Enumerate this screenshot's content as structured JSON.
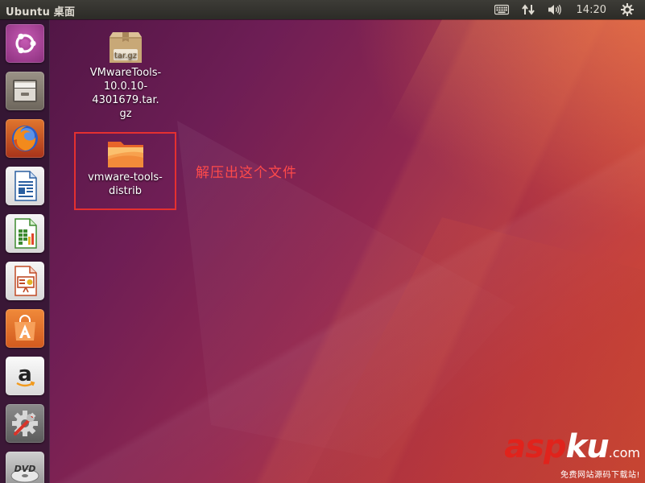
{
  "panel": {
    "title": "Ubuntu 桌面",
    "clock": "14:20",
    "indicators": [
      "keyboard-icon",
      "network-arrows-icon",
      "volume-icon",
      "power-gear-icon"
    ]
  },
  "launcher": {
    "items": [
      {
        "name": "ubuntu-dash",
        "icon": "ubuntu-logo-icon",
        "color": "#9c3b8c"
      },
      {
        "name": "files",
        "icon": "file-cabinet-icon",
        "color": "#8a8073"
      },
      {
        "name": "firefox",
        "icon": "firefox-icon",
        "color": "#d9541a"
      },
      {
        "name": "libreoffice-writer",
        "icon": "writer-document-icon",
        "color": "#2a5fa0"
      },
      {
        "name": "libreoffice-calc",
        "icon": "calc-spreadsheet-icon",
        "color": "#3d8a2f"
      },
      {
        "name": "libreoffice-impress",
        "icon": "impress-presentation-icon",
        "color": "#c04a25"
      },
      {
        "name": "ubuntu-software",
        "icon": "software-bag-icon",
        "color": "#e8702a"
      },
      {
        "name": "amazon",
        "icon": "amazon-icon",
        "color": "#e6e6e6"
      },
      {
        "name": "system-settings",
        "icon": "settings-tools-icon",
        "color": "#6a6a6a"
      },
      {
        "name": "dvd",
        "icon": "dvd-disc-icon",
        "color": "#b0b0b0"
      }
    ]
  },
  "desktop": {
    "archive": {
      "badge": "tar.gz",
      "label_lines": [
        "VMwareTools-",
        "10.0.10-4301679.tar.",
        "gz"
      ]
    },
    "folder": {
      "label_lines": [
        "vmware-tools-",
        "distrib"
      ]
    },
    "annotation": "解压出这个文件"
  },
  "watermark": {
    "main_red": "asp",
    "main_white": "ku",
    "suffix": ".com",
    "sub": "免费网站源码下载站!"
  }
}
